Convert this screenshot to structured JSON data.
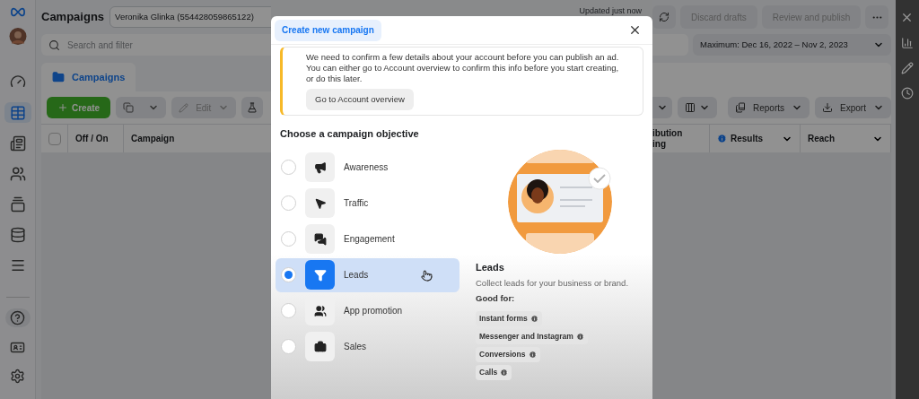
{
  "sidebar": {
    "items": [
      {
        "selected": false
      },
      {
        "selected": true
      },
      {
        "selected": false
      },
      {
        "selected": false
      },
      {
        "selected": false
      },
      {
        "selected": false
      },
      {
        "selected": false
      }
    ],
    "bottom_items": [
      {
        "selected": false
      },
      {
        "selected": false
      },
      {
        "selected": false
      }
    ]
  },
  "header": {
    "title": "Campaigns",
    "account": "Veronika Glinka (554428059865122)",
    "status": "Updated just now",
    "buttons": [
      {
        "label": "Discard drafts",
        "disabled": true
      },
      {
        "label": "Review and publish",
        "disabled": true
      }
    ]
  },
  "search": {
    "placeholder": "Search and filter"
  },
  "date_range": "Maximum: Dec 16, 2022 – Nov 2, 2023",
  "tab": {
    "label": "Campaigns"
  },
  "toolbar": {
    "create": "Create",
    "edit": {
      "label": "Edit",
      "disabled": true
    },
    "reports": "Reports",
    "export": "Export"
  },
  "table": {
    "select_all": {
      "checked": false
    },
    "columns_left": [
      "Off / On",
      "Campaign"
    ],
    "columns_right": [
      {
        "lines": [
          "ibution",
          "ing"
        ],
        "info": false,
        "sortable": false
      },
      {
        "lines": [
          "Results"
        ],
        "info": true,
        "sortable": true
      },
      {
        "lines": [
          "Reach"
        ],
        "info": false,
        "sortable": true
      }
    ]
  },
  "modal": {
    "tab": "Create new campaign",
    "notice": {
      "text": "We need to confirm a few details about your account before you can publish an ad. You can either go to Account overview to confirm this info before you start creating, or do this later.",
      "button": "Go to Account overview"
    },
    "heading": "Choose a campaign objective",
    "objectives": [
      {
        "label": "Awareness",
        "selected": false
      },
      {
        "label": "Traffic",
        "selected": false
      },
      {
        "label": "Engagement",
        "selected": false
      },
      {
        "label": "Leads",
        "selected": true
      },
      {
        "label": "App promotion",
        "selected": false
      },
      {
        "label": "Sales",
        "selected": false
      }
    ],
    "detail": {
      "title": "Leads",
      "description": "Collect leads for your business or brand.",
      "good_for_label": "Good for:",
      "tags": [
        "Instant forms",
        "Messenger and Instagram",
        "Conversions",
        "Calls"
      ]
    }
  }
}
